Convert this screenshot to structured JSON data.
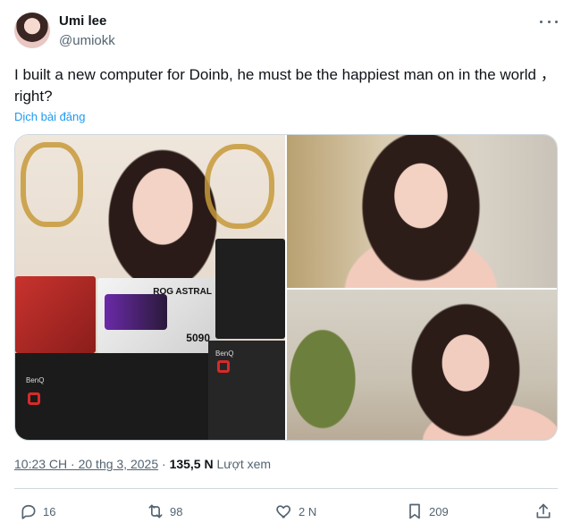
{
  "author": {
    "name": "Umi lee",
    "handle": "@umiokk"
  },
  "tweet": {
    "text": "I built a new computer for Doinb, he must be the happiest man on in the world ，right?",
    "translate_label": "Dịch bài đăng"
  },
  "media": {
    "images": [
      "photo-setup-with-pc-parts",
      "photo-portrait-1",
      "photo-portrait-2"
    ],
    "visible_box_text": [
      "ROG ASTRAL",
      "5090",
      "BenQ",
      "BenQ"
    ]
  },
  "meta": {
    "time": "10:23 CH · 20 thg 3, 2025",
    "separator": "·",
    "views_count": "135,5 N",
    "views_label": "Lượt xem"
  },
  "actions": {
    "replies": "16",
    "retweets": "98",
    "likes": "2 N",
    "bookmarks": "209"
  },
  "colors": {
    "text": "#0f1419",
    "muted": "#536471",
    "link": "#1d9bf0",
    "border": "#cfd9de"
  }
}
